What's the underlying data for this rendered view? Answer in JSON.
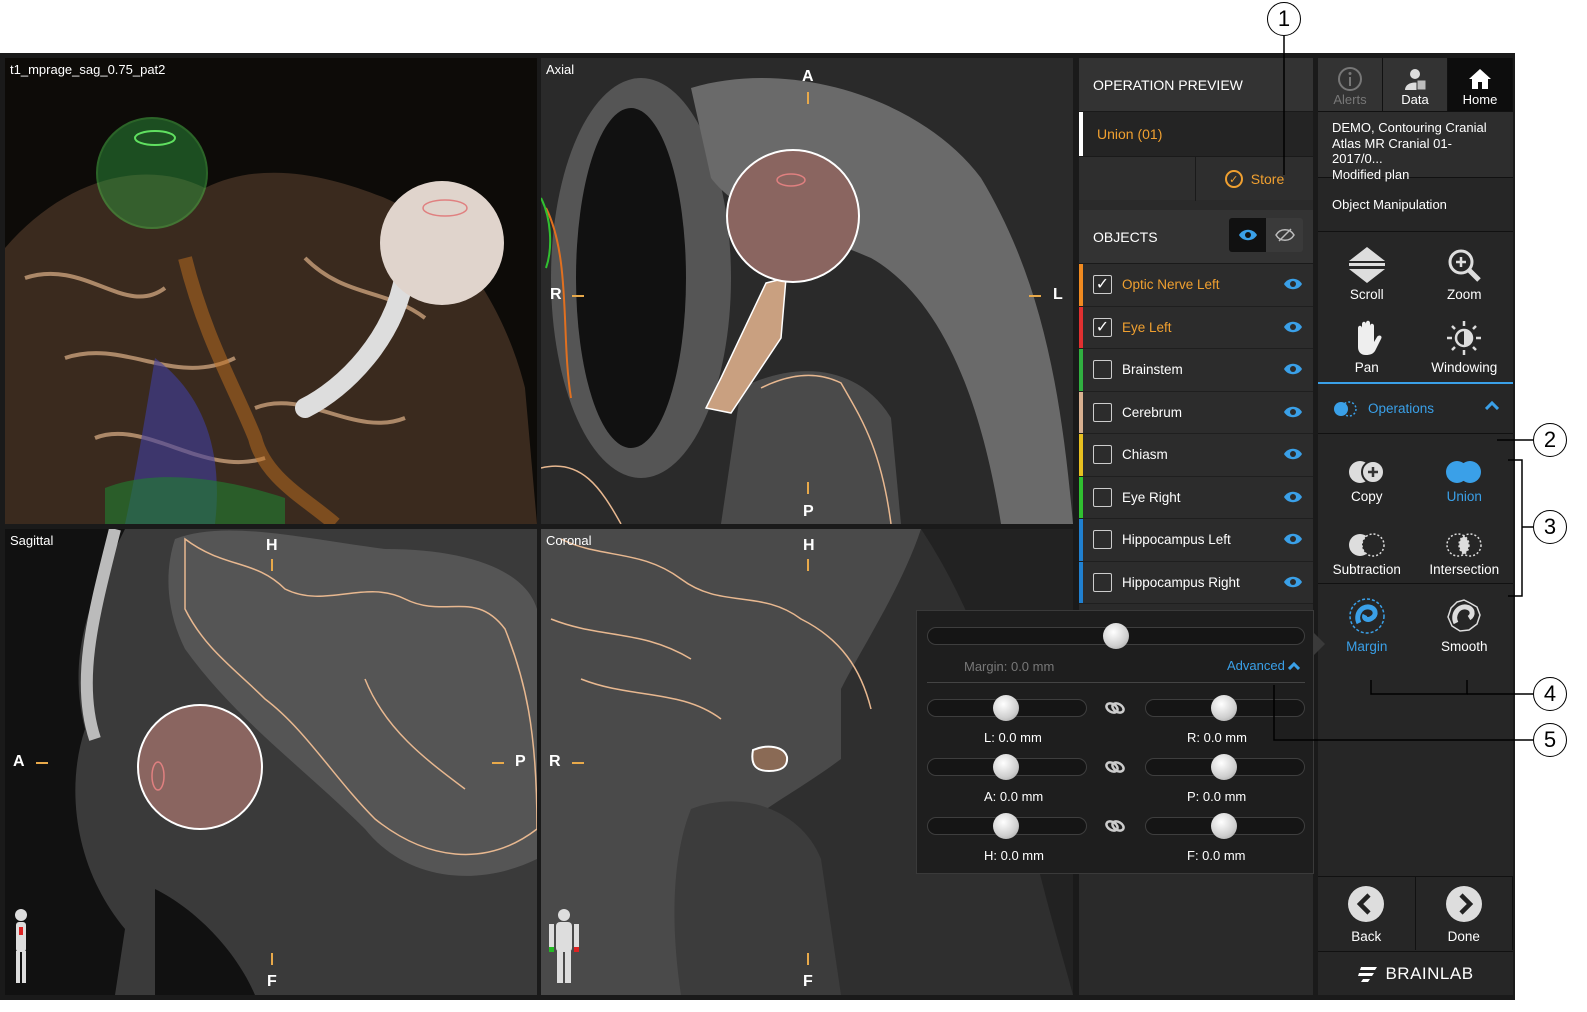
{
  "views": {
    "v3d_title": "t1_mprage_sag_0.75_pat2",
    "axial_title": "Axial",
    "sagittal_title": "Sagittal",
    "coronal_title": "Coronal",
    "axial": {
      "top": "A",
      "bottom": "P",
      "left": "R",
      "right": "L"
    },
    "sagittal": {
      "top": "H",
      "bottom": "F",
      "left": "A",
      "right": "P"
    },
    "coronal": {
      "top": "H",
      "bottom": "F",
      "left": "R"
    }
  },
  "operation_preview": {
    "header": "OPERATION PREVIEW",
    "item": "Union (01)",
    "store_label": "Store"
  },
  "objects": {
    "header": "OBJECTS",
    "items": [
      {
        "label": "Optic Nerve Left",
        "checked": "✓",
        "color": "#f08a20",
        "selected": true
      },
      {
        "label": "Eye Left",
        "checked": "✓",
        "color": "#e03030",
        "selected": true
      },
      {
        "label": "Brainstem",
        "checked": "",
        "color": "#30b040",
        "selected": false
      },
      {
        "label": "Cerebrum",
        "checked": "",
        "color": "#d8b090",
        "selected": false
      },
      {
        "label": "Chiasm",
        "checked": "",
        "color": "#e8c020",
        "selected": false
      },
      {
        "label": "Eye Right",
        "checked": "",
        "color": "#30c030",
        "selected": false
      },
      {
        "label": "Hippocampus Left",
        "checked": "",
        "color": "#2080d0",
        "selected": false
      },
      {
        "label": "Hippocampus Right",
        "checked": "",
        "color": "#2080d0",
        "selected": false
      }
    ]
  },
  "nav": {
    "alerts": "Alerts",
    "data": "Data",
    "home": "Home"
  },
  "plan": {
    "line1": "DEMO, Contouring Cranial",
    "line2": "Atlas MR Cranial 01-2017/0...",
    "line3": "Modified plan"
  },
  "object_manipulation": "Object Manipulation",
  "tools": {
    "scroll": "Scroll",
    "zoom": "Zoom",
    "pan": "Pan",
    "windowing": "Windowing"
  },
  "operations": {
    "label": "Operations",
    "copy": "Copy",
    "union": "Union",
    "subtraction": "Subtraction",
    "intersection": "Intersection",
    "margin": "Margin",
    "smooth": "Smooth"
  },
  "margin_popup": {
    "margin_label": "Margin: 0.0 mm",
    "advanced": "Advanced",
    "l": "L: 0.0 mm",
    "r": "R: 0.0 mm",
    "a": "A: 0.0 mm",
    "p": "P: 0.0 mm",
    "h": "H: 0.0 mm",
    "f": "F: 0.0 mm"
  },
  "bottom": {
    "back": "Back",
    "done": "Done"
  },
  "brand": "BRAINLAB",
  "callouts": [
    "1",
    "2",
    "3",
    "4",
    "5"
  ],
  "colors": {
    "accent_blue": "#3aa0e8",
    "accent_orange": "#f0a030"
  }
}
